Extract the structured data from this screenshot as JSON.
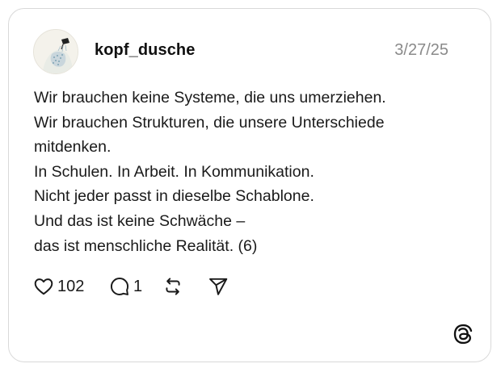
{
  "post": {
    "username": "kopf_dusche",
    "date": "3/27/25",
    "lines": [
      "Wir brauchen keine Systeme, die uns umerziehen.",
      "Wir brauchen Strukturen, die unsere Unterschiede",
      "mitdenken.",
      "In Schulen. In Arbeit. In Kommunikation.",
      "Nicht jeder passt in dieselbe Schablone.",
      "Und das ist keine Schwäche –",
      "das ist menschliche Realität. (6)"
    ]
  },
  "actions": {
    "like_icon": "heart-icon",
    "like_count": "102",
    "reply_icon": "comment-icon",
    "reply_count": "1",
    "repost_icon": "repost-icon",
    "share_icon": "send-icon"
  },
  "brand": {
    "logo_icon": "threads-logo"
  },
  "colors": {
    "text": "#111111",
    "muted": "#8a8a8a",
    "border": "#d9d9d9"
  }
}
